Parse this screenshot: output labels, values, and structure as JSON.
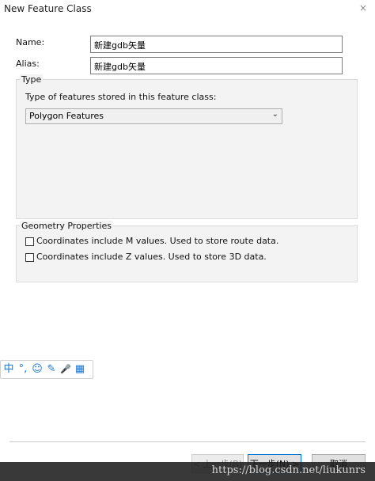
{
  "window": {
    "title": "New Feature Class",
    "close_glyph": "×"
  },
  "form": {
    "name_label": "Name:",
    "name_value": "新建gdb矢量",
    "alias_label": "Alias:",
    "alias_value": "新建gdb矢量"
  },
  "type_group": {
    "legend": "Type",
    "description": "Type of features stored in this feature class:",
    "selected": "Polygon Features"
  },
  "geometry_group": {
    "legend": "Geometry Properties",
    "options": [
      {
        "label": "Coordinates include M values. Used to store route data.",
        "checked": false
      },
      {
        "label": "Coordinates include Z values. Used to store 3D data.",
        "checked": false
      }
    ]
  },
  "ime_toolbar": {
    "items": [
      {
        "glyph": "中",
        "icon": "chinese-mode-icon"
      },
      {
        "glyph": "°,",
        "icon": "punctuation-icon"
      },
      {
        "glyph": "☺",
        "icon": "emoji-icon"
      },
      {
        "glyph": "✎",
        "icon": "handwriting-icon"
      },
      {
        "glyph": "🎤",
        "icon": "microphone-icon"
      },
      {
        "glyph": "▦",
        "icon": "toolbox-icon"
      }
    ]
  },
  "buttons": {
    "back": "< 上一步(B)",
    "next": "下一步(N) >",
    "cancel": "取消"
  },
  "watermark": "https://blog.csdn.net/liukunrs"
}
